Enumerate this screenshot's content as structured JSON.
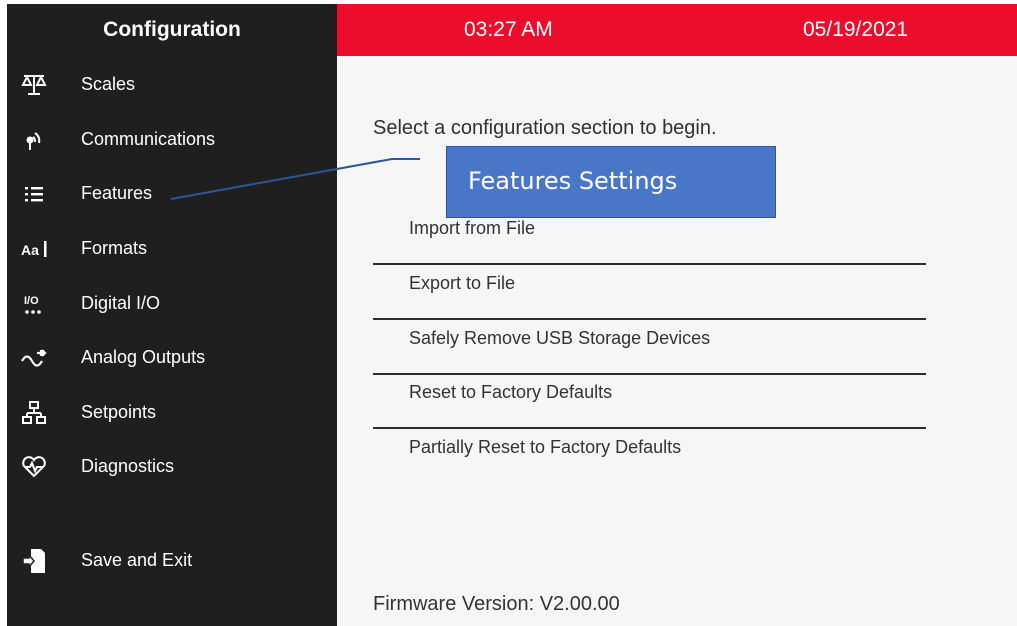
{
  "sidebar": {
    "title": "Configuration",
    "items": [
      {
        "label": "Scales",
        "icon": "scale-icon"
      },
      {
        "label": "Communications",
        "icon": "antenna-icon"
      },
      {
        "label": "Features",
        "icon": "list-icon"
      },
      {
        "label": "Formats",
        "icon": "text-format-icon"
      },
      {
        "label": "Digital I/O",
        "icon": "io-icon"
      },
      {
        "label": "Analog Outputs",
        "icon": "analog-output-icon"
      },
      {
        "label": "Setpoints",
        "icon": "hierarchy-icon"
      },
      {
        "label": "Diagnostics",
        "icon": "heartbeat-icon"
      },
      {
        "label": "Save and Exit",
        "icon": "exit-door-icon"
      }
    ]
  },
  "header": {
    "time": "03:27 AM",
    "date": "05/19/2021"
  },
  "main": {
    "prompt": "Select a configuration section to begin.",
    "menu": [
      {
        "label": "Import from File"
      },
      {
        "label": "Export to File"
      },
      {
        "label": "Safely Remove USB Storage Devices"
      },
      {
        "label": "Reset to Factory Defaults"
      },
      {
        "label": "Partially Reset to Factory Defaults"
      }
    ],
    "firmware": "Firmware Version: V2.00.00"
  },
  "annotation": {
    "callout_text": "Features Settings"
  },
  "colors": {
    "sidebar_bg": "#1f1f1f",
    "header_bg": "#ec0c2c",
    "content_bg": "#f6f6f6",
    "callout_bg": "#4a76c8",
    "leader_line": "#2e5597"
  }
}
